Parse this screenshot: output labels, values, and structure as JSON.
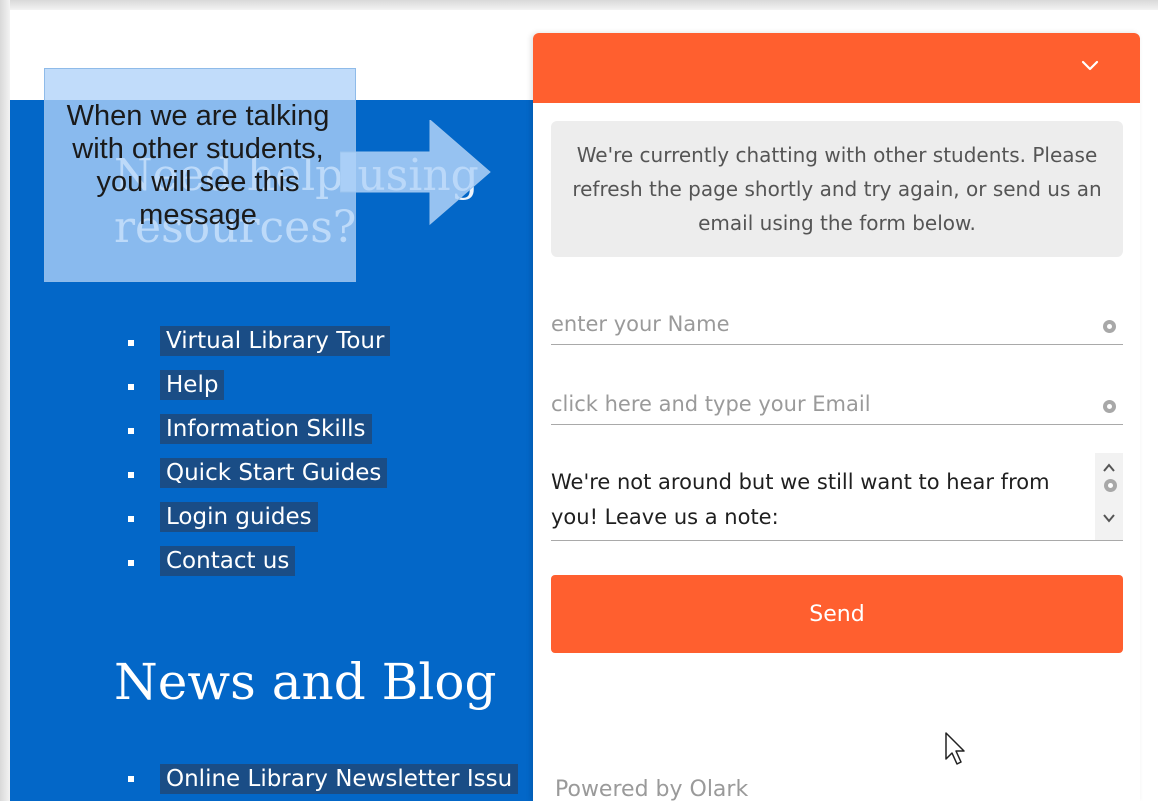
{
  "page": {
    "hero_title": "Need help using resources?",
    "links": [
      "Virtual Library Tour",
      "Help",
      "Information Skills",
      "Quick Start Guides",
      "Login guides",
      "Contact us"
    ],
    "news_title": "News and Blog",
    "bottom_link": "Online Library Newsletter Issu"
  },
  "callout": {
    "text": "When we are talking with other students, you will see this message"
  },
  "chat": {
    "notice": "We're currently chatting with other students. Please refresh the page shortly and try again, or send us an email using the form below.",
    "name_placeholder": "enter your Name",
    "email_placeholder": "click here and type your Email",
    "message": "We're not around but we still want to hear from you!  Leave us a note:",
    "send_label": "Send",
    "powered_by": "Powered by Olark"
  },
  "colors": {
    "accent": "#ff5f2f",
    "page_blue": "#0367c8",
    "callout": "#b0d2f8"
  },
  "icons": [
    "chevron-down-icon",
    "required-field-icon",
    "scroll-up-icon",
    "scroll-down-icon",
    "mouse-cursor-icon",
    "callout-arrow"
  ]
}
